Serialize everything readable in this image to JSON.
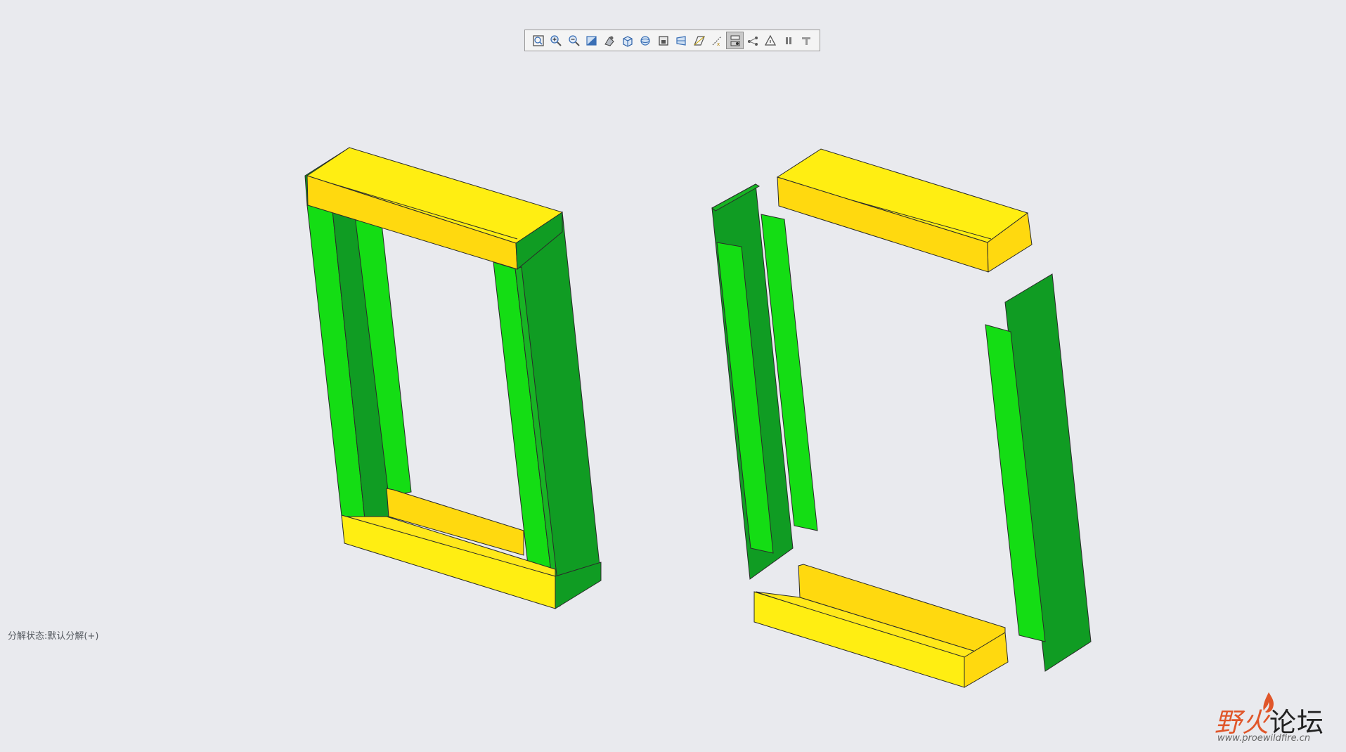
{
  "toolbar": {
    "buttons": [
      {
        "icon": "refit-icon"
      },
      {
        "icon": "zoom-in-icon"
      },
      {
        "icon": "zoom-out-icon"
      },
      {
        "icon": "repaint-icon"
      },
      {
        "icon": "reorient-icon"
      },
      {
        "icon": "saved-views-icon"
      },
      {
        "icon": "display-style-icon"
      },
      {
        "icon": "view-manager-icon"
      },
      {
        "icon": "perspective-icon"
      },
      {
        "icon": "datum-planes-icon"
      },
      {
        "icon": "datum-axes-icon"
      },
      {
        "icon": "explode-view-icon",
        "active": true
      },
      {
        "icon": "datum-points-icon"
      },
      {
        "icon": "csys-icon"
      },
      {
        "icon": "pause-icon"
      },
      {
        "icon": "annotations-icon"
      }
    ]
  },
  "status": {
    "explode_state": "分解状态:默认分解(+)"
  },
  "watermark": {
    "title_part1": "野火",
    "title_part2": "论坛",
    "url": "www.proewildfire.cn"
  },
  "colors": {
    "background": "#e9eaee",
    "channel_yellow": "#ffee12",
    "channel_yellow_dark": "#ffd90f",
    "channel_green": "#14dd14",
    "channel_green_dark": "#109c23",
    "edge": "#2a2a2a",
    "watermark_red": "#e0562a"
  }
}
